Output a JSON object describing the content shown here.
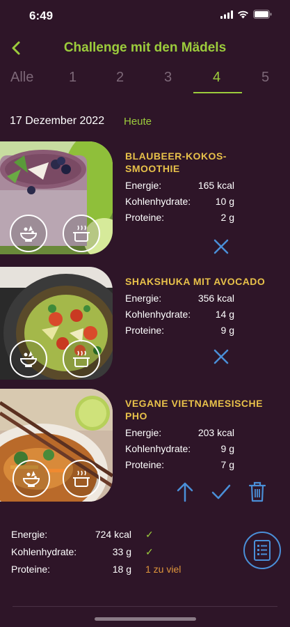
{
  "status_bar": {
    "time": "6:49"
  },
  "nav": {
    "title": "Challenge mit den Mädels"
  },
  "tabs": [
    {
      "label": "Alle"
    },
    {
      "label": "1"
    },
    {
      "label": "2"
    },
    {
      "label": "3"
    },
    {
      "label": "4",
      "active": true
    },
    {
      "label": "5"
    }
  ],
  "date": {
    "text": "17 Dezember 2022",
    "today_label": "Heute"
  },
  "meals": [
    {
      "title": "BLAUBEER-KOKOS-SMOOTHIE",
      "rows": [
        {
          "label": "Energie:",
          "value": "165 kcal"
        },
        {
          "label": "Kohlenhydrate:",
          "value": "10 g"
        },
        {
          "label": "Proteine:",
          "value": "2 g"
        }
      ]
    },
    {
      "title": "SHAKSHUKA MIT AVOCADO",
      "rows": [
        {
          "label": "Energie:",
          "value": "356 kcal"
        },
        {
          "label": "Kohlenhydrate:",
          "value": "14 g"
        },
        {
          "label": "Proteine:",
          "value": "9 g"
        }
      ]
    },
    {
      "title": "VEGANE VIETNAMESISCHE PHO",
      "rows": [
        {
          "label": "Energie:",
          "value": "203 kcal"
        },
        {
          "label": "Kohlenhydrate:",
          "value": "9 g"
        },
        {
          "label": "Proteine:",
          "value": "7 g"
        }
      ]
    }
  ],
  "summary": {
    "rows": [
      {
        "label": "Energie:",
        "value": "724 kcal",
        "status": "✓"
      },
      {
        "label": "Kohlenhydrate:",
        "value": "33 g",
        "status": "✓"
      },
      {
        "label": "Proteine:",
        "value": "18 g",
        "status": "1 zu viel"
      }
    ]
  },
  "icons": {
    "back": "chevron-left-icon",
    "remove": "close-icon",
    "move_up": "arrow-up-icon",
    "done": "check-icon",
    "delete": "trash-icon",
    "ingredients": "salad-bowl-icon",
    "cook": "cooking-pot-icon",
    "shopping_list": "list-icon"
  },
  "colors": {
    "background": "#2e1528",
    "accent_green": "#9ccc3c",
    "title_gold": "#e8c14a",
    "action_blue": "#4a8fd8",
    "warning_orange": "#e0963c"
  }
}
